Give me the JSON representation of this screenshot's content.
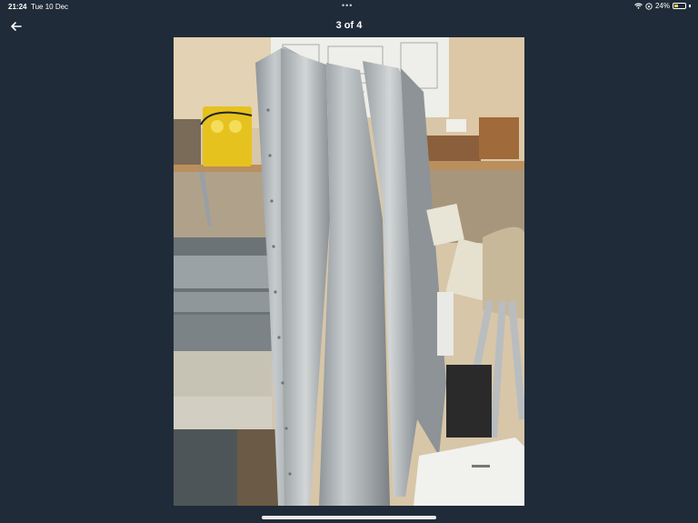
{
  "status_bar": {
    "time": "21:24",
    "date": "Tue 10 Dec",
    "battery": "24%",
    "icons": [
      "wifi-icon",
      "orientation-lock-icon",
      "battery-charging-icon"
    ]
  },
  "header": {
    "title": "3 of 4",
    "back_icon": "arrow-left-icon",
    "more_icon": "more-dots-icon"
  },
  "image": {
    "description_icon": "photo-viewer-image"
  },
  "colors": {
    "background": "#1f2b38",
    "text": "#ffffff",
    "home_indicator": "#e8e8e8"
  }
}
